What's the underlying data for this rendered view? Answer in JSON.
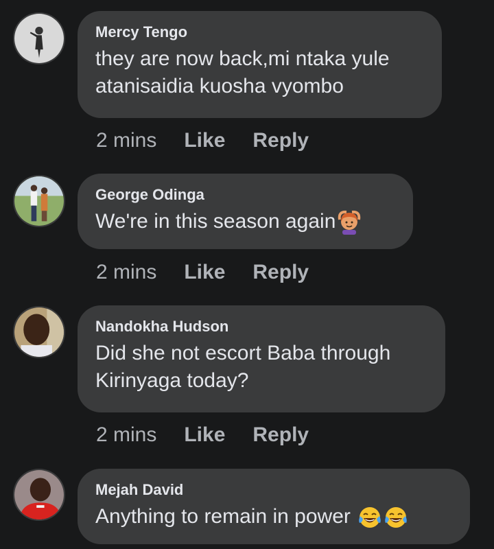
{
  "comments": [
    {
      "author": "Mercy Tengo",
      "text": "they are now back,mi ntaka yule\natanisaidia kuosha vyombo",
      "time": "2 mins",
      "like_label": "Like",
      "reply_label": "Reply",
      "avatar_icon": "avatar-photo"
    },
    {
      "author": "George Odinga",
      "text": "We're in this season again",
      "emoji": [
        "person-gesturing-ok-emoji"
      ],
      "time": "2 mins",
      "like_label": "Like",
      "reply_label": "Reply",
      "avatar_icon": "avatar-photo"
    },
    {
      "author": "Nandokha Hudson",
      "text": "Did she not escort Baba through\nKirinyaga today?",
      "time": "2 mins",
      "like_label": "Like",
      "reply_label": "Reply",
      "avatar_icon": "avatar-photo"
    },
    {
      "author": "Mejah David",
      "text": "Anything to remain in power ",
      "emoji": [
        "face-with-tears-of-joy-emoji",
        "face-with-tears-of-joy-emoji"
      ],
      "avatar_icon": "avatar-photo"
    }
  ],
  "colors": {
    "background": "#18191a",
    "bubble": "#3a3b3c",
    "text": "#e4e6eb",
    "secondary": "#b0b3b8"
  }
}
